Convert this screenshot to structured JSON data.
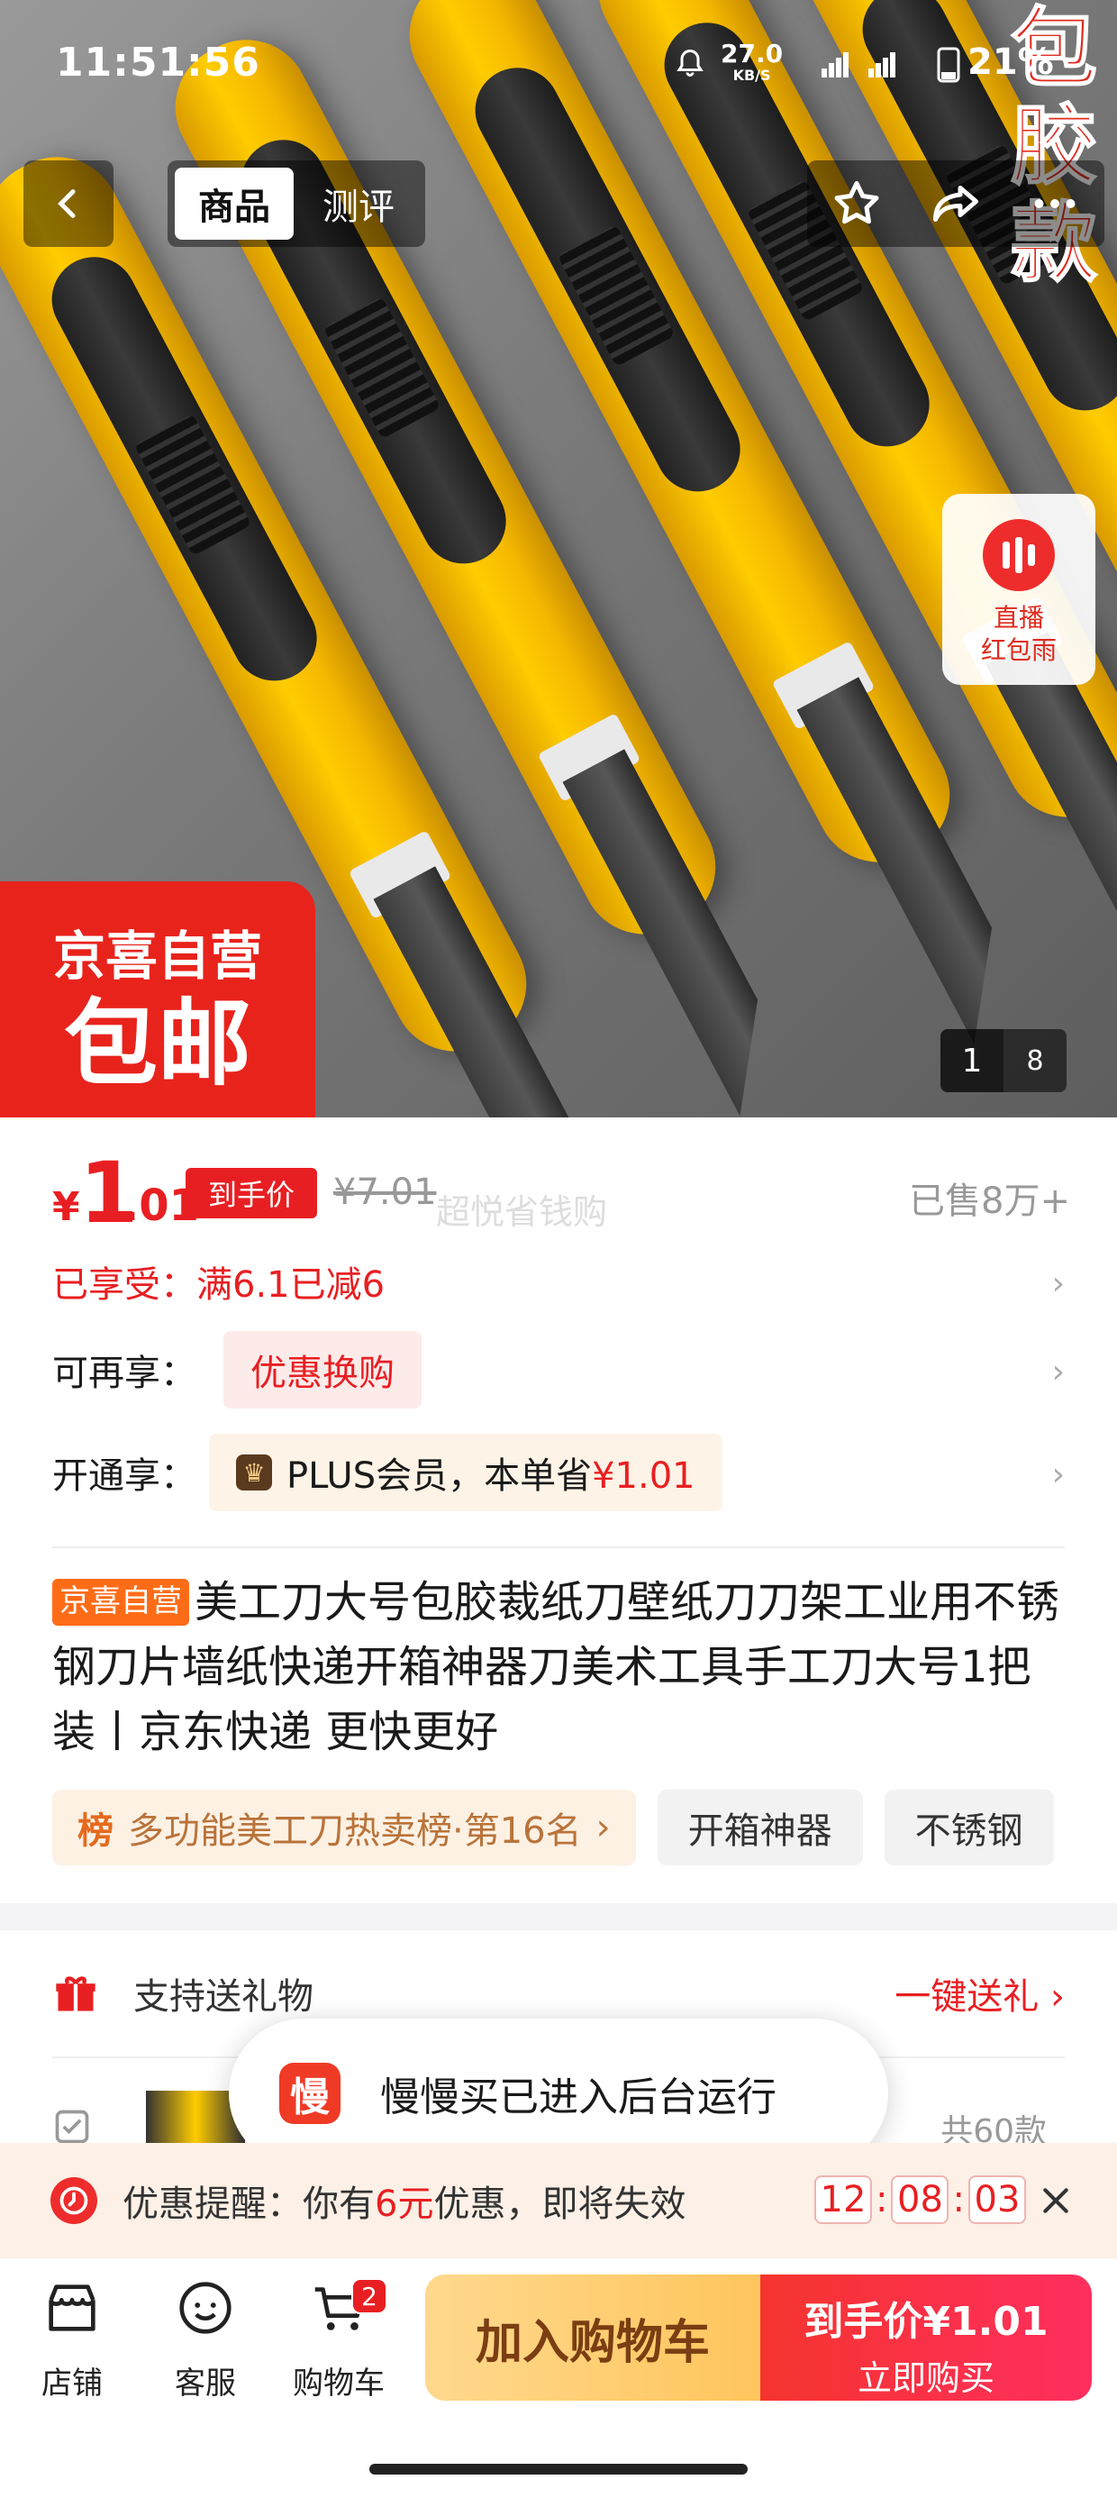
{
  "status": {
    "time": "11:51:56",
    "net_speed": "27.0",
    "net_unit": "KB/S",
    "battery": "21%"
  },
  "hero": {
    "corner_promo": [
      "包",
      "胶",
      "款"
    ],
    "tabs": [
      {
        "label": "商品"
      },
      {
        "label": "测评"
      }
    ],
    "live": {
      "line1": "直播",
      "line2": "红包雨"
    },
    "badge": {
      "line1": "京喜自营",
      "line2": "包邮"
    },
    "pager": {
      "current": "1",
      "total": "8"
    }
  },
  "price": {
    "currency": "¥",
    "integer": "1",
    "decimal": ".01",
    "tag": "到手价",
    "original": "¥7.01",
    "watermark": "超悦省钱购",
    "sold": "已售8万+"
  },
  "rows": {
    "enjoyed": "已享受：满6.1已减6",
    "more_label": "可再享：",
    "more_chip": "优惠换购",
    "plus_label": "开通享：",
    "plus_text": "PLUS会员，本单省",
    "plus_amount": "¥1.01"
  },
  "product": {
    "tag": "京喜自营",
    "title": "美工刀大号包胶裁纸刀壁纸刀刀架工业用不锈钢刀片墙纸快递开箱神器刀美术工具手工刀大号1把装丨京东快递 更快更好"
  },
  "rank": {
    "icon": "榜",
    "text": "多功能美工刀热卖榜·第16名",
    "keywords": [
      "开箱神器",
      "不锈钢"
    ]
  },
  "gift": {
    "label": "支持送礼物",
    "action": "一键送礼"
  },
  "peek": {
    "right_text": "共60款"
  },
  "toast": {
    "icon_char": "慢",
    "text": "慢慢买已进入后台运行"
  },
  "reminder": {
    "prefix": "优惠提醒：你有",
    "amount": "6元",
    "suffix": "优惠，即将失效",
    "h": "12",
    "m": "08",
    "s": "03"
  },
  "bottom": {
    "shop": "店铺",
    "service": "客服",
    "cart": "购物车",
    "cart_count": "2",
    "add_cart": "加入购物车",
    "buy_price": "到手价¥1.01",
    "buy_now": "立即购买"
  },
  "colors": {
    "accent_red": "#e81f22",
    "knife_yellow": "#ffcc00",
    "jingxi_orange": "#ff6c17"
  }
}
